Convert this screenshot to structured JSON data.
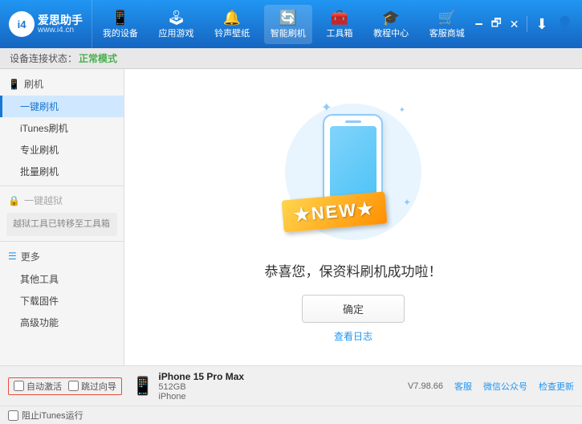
{
  "header": {
    "logo_text": "www.i4.cn",
    "logo_short": "i4",
    "nav": [
      {
        "label": "我的设备",
        "icon": "📱"
      },
      {
        "label": "应用游戏",
        "icon": "🕹"
      },
      {
        "label": "铃声壁纸",
        "icon": "🔔"
      },
      {
        "label": "智能刷机",
        "icon": "🔄"
      },
      {
        "label": "工具箱",
        "icon": "🧰"
      },
      {
        "label": "教程中心",
        "icon": "🎓"
      },
      {
        "label": "客服商城",
        "icon": "🛒"
      }
    ],
    "right_btn_download": "⬇",
    "right_btn_user": "👤"
  },
  "subheader": {
    "prefix": "设备连接状态：",
    "status": "正常模式"
  },
  "sidebar": {
    "sections": [
      {
        "header": "刷机",
        "icon": "📱",
        "items": [
          {
            "label": "一键刷机",
            "active": true
          },
          {
            "label": "iTunes刷机",
            "active": false
          },
          {
            "label": "专业刷机",
            "active": false
          },
          {
            "label": "批量刷机",
            "active": false
          }
        ]
      },
      {
        "header": "一键越狱",
        "disabled": true,
        "warning": "越狱工具已转移至工具箱"
      },
      {
        "header": "更多",
        "icon": "☰",
        "items": [
          {
            "label": "其他工具",
            "active": false
          },
          {
            "label": "下载固件",
            "active": false
          },
          {
            "label": "高级功能",
            "active": false
          }
        ]
      }
    ]
  },
  "main": {
    "success_text": "恭喜您，保资料刷机成功啦！",
    "confirm_label": "确定",
    "log_label": "查看日志"
  },
  "footer": {
    "auto_activate_label": "自动激活",
    "guide_label": "跳过向导",
    "device_name": "iPhone 15 Pro Max",
    "device_storage": "512GB",
    "device_type": "iPhone",
    "version_label": "V7.98.66",
    "feedback_label": "客服",
    "wechat_label": "微信公众号",
    "check_update_label": "检查更新",
    "itunes_label": "阻止iTunes运行"
  }
}
